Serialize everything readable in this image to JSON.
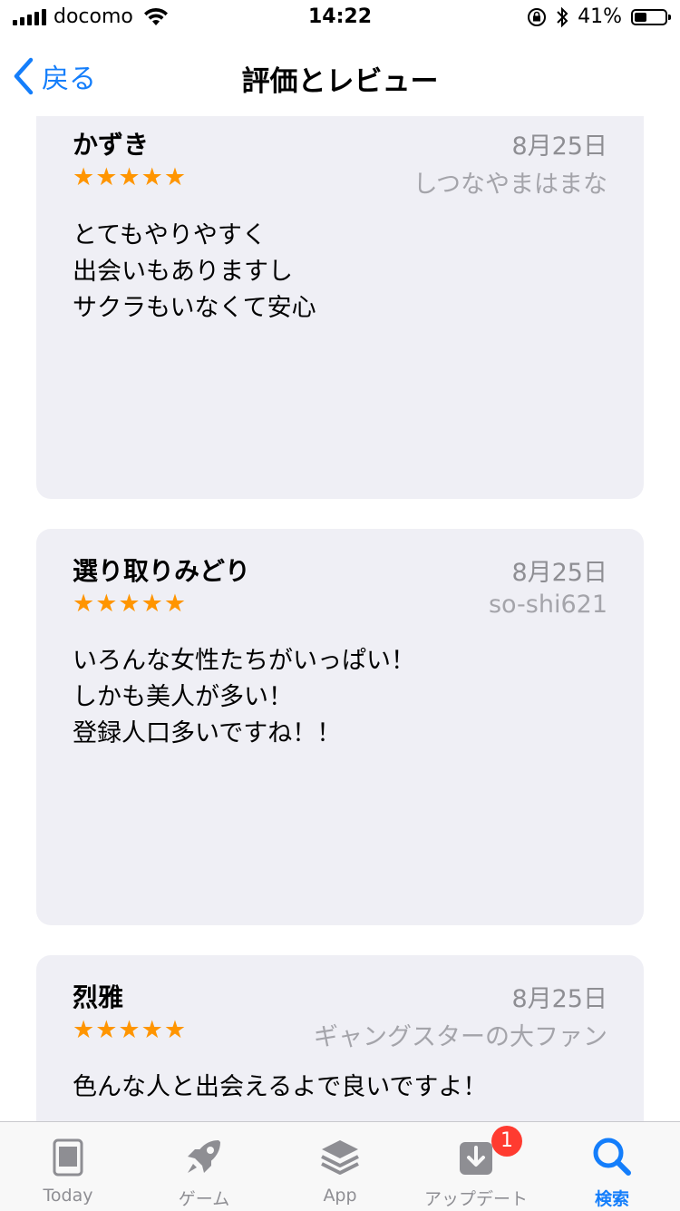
{
  "status_bar": {
    "carrier": "docomo",
    "time": "14:22",
    "battery_text": "41%",
    "battery_level": 0.41
  },
  "nav": {
    "back_label": "戻る",
    "title": "評価とレビュー"
  },
  "reviews": [
    {
      "title": "かずき",
      "date": "8月25日",
      "stars": "★★★★★",
      "author": "しつなやまはまな",
      "body": [
        "とてもやりやすく",
        "出会いもありますし",
        "サクラもいなくて安心"
      ]
    },
    {
      "title": "選り取りみどり",
      "date": "8月25日",
      "stars": "★★★★★",
      "author": "so-shi621",
      "body": [
        "いろんな女性たちがいっぱい！",
        "しかも美人が多い！",
        "登録人口多いですね！！"
      ]
    },
    {
      "title": "烈雅",
      "date": "8月25日",
      "stars": "★★★★★",
      "author": "ギャングスターの大ファン",
      "body": [
        "色んな人と出会えるよで良いですよ！"
      ]
    }
  ],
  "tab_bar": {
    "tabs": [
      {
        "label": "Today"
      },
      {
        "label": "ゲーム"
      },
      {
        "label": "App"
      },
      {
        "label": "アップデート",
        "badge": "1"
      },
      {
        "label": "検索"
      }
    ],
    "active_tab": "検索"
  },
  "colors": {
    "accent": "#147efb",
    "star": "#ff9500",
    "card_bg": "#efeff5",
    "badge": "#ff3b30",
    "secondary_text": "#8e8e93"
  }
}
